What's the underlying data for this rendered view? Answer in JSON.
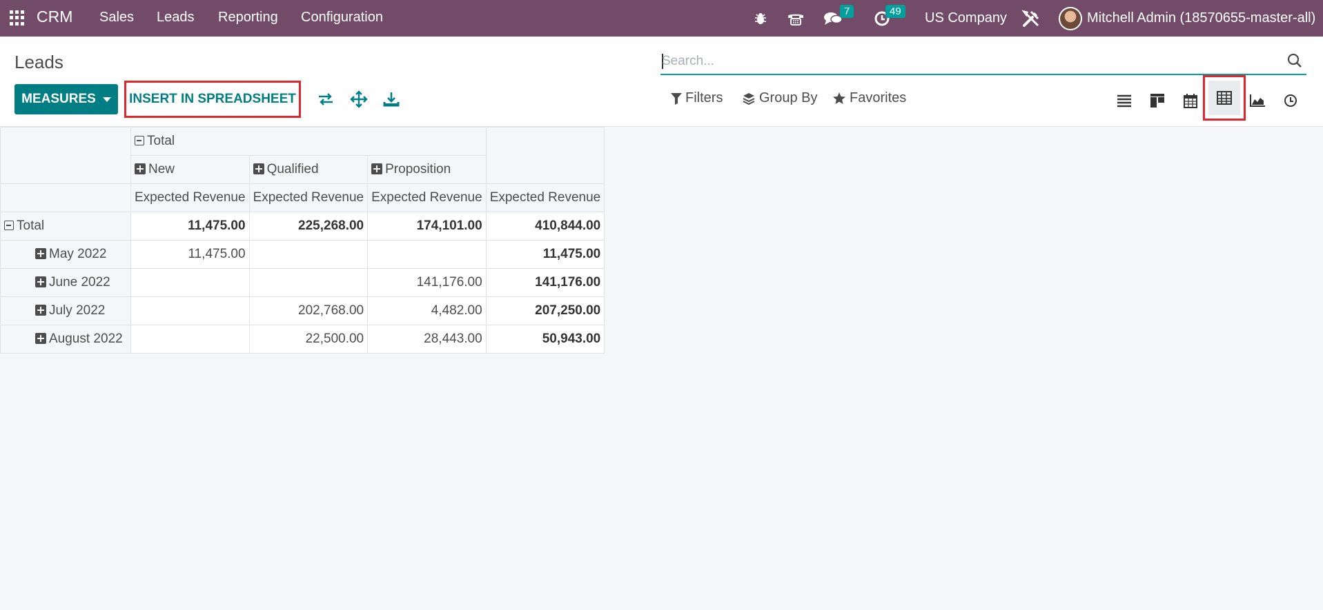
{
  "navbar": {
    "app_name": "CRM",
    "menu": [
      "Sales",
      "Leads",
      "Reporting",
      "Configuration"
    ],
    "messages_count": "7",
    "activities_count": "49",
    "company": "US Company",
    "user": "Mitchell Admin (18570655-master-all)"
  },
  "control_panel": {
    "breadcrumb": "Leads",
    "search_placeholder": "Search...",
    "measures_label": "MEASURES",
    "insert_label": "INSERT IN SPREADSHEET",
    "filters_label": "Filters",
    "groupby_label": "Group By",
    "favorites_label": "Favorites",
    "views": [
      "list-view",
      "kanban-view",
      "calendar-view",
      "pivot-view",
      "graph-view",
      "activity-view"
    ],
    "active_view": "pivot-view",
    "accent_color": "#017e84",
    "highlight_color": "#e0262e"
  },
  "pivot": {
    "col_group_total": "Total",
    "col_groups": [
      "New",
      "Qualified",
      "Proposition"
    ],
    "measure": "Expected Revenue",
    "row_total_label": "Total",
    "total_row": [
      "11,475.00",
      "225,268.00",
      "174,101.00",
      "410,844.00"
    ],
    "rows": [
      {
        "label": "May 2022",
        "cells": [
          "11,475.00",
          "",
          "",
          "11,475.00"
        ]
      },
      {
        "label": "June 2022",
        "cells": [
          "",
          "",
          "141,176.00",
          "141,176.00"
        ]
      },
      {
        "label": "July 2022",
        "cells": [
          "",
          "202,768.00",
          "4,482.00",
          "207,250.00"
        ]
      },
      {
        "label": "August 2022",
        "cells": [
          "",
          "22,500.00",
          "28,443.00",
          "50,943.00"
        ]
      }
    ]
  }
}
